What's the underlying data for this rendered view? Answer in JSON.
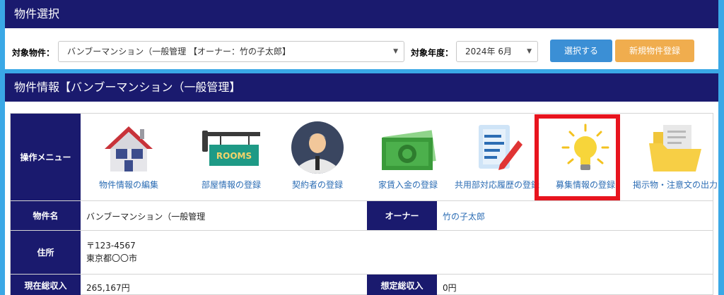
{
  "panel1": {
    "title": "物件選択",
    "property_label": "対象物件：",
    "property_value": "バンブーマンション（一般管理 【オーナー：竹の子太郎】",
    "year_label": "対象年度：",
    "year_value": "2024年 6月",
    "select_button": "選択する",
    "new_button": "新規物件登録"
  },
  "panel2": {
    "title": "物件情報【バンブーマンション（一般管理】",
    "menu_label": "操作メニュー",
    "menu": [
      {
        "label": "物件情報の編集",
        "icon": "house-icon"
      },
      {
        "label": "部屋情報の登録",
        "icon": "rooms-sign-icon",
        "sign_text": "ROOMS"
      },
      {
        "label": "契約者の登録",
        "icon": "person-icon"
      },
      {
        "label": "家賃入金の登録",
        "icon": "money-icon"
      },
      {
        "label": "共用部対応履歴の登録",
        "icon": "document-pen-icon"
      },
      {
        "label": "募集情報の登録",
        "icon": "lightbulb-icon"
      },
      {
        "label": "掲示物・注意文の出力",
        "icon": "folder-icon"
      }
    ],
    "property_name_label": "物件名",
    "property_name": "バンブーマンション（一般管理",
    "owner_label": "オーナー",
    "owner": "竹の子太郎",
    "address_label": "住所",
    "postal": "〒123-4567",
    "address": "東京都〇〇市",
    "income_label": "現在総収入",
    "income": "265,167円",
    "expected_label": "想定総収入",
    "expected": "0円"
  },
  "colors": {
    "navy": "#1a1a6e",
    "background": "#3aa8e6",
    "select_button": "#3b8fd5",
    "new_button": "#f0ad4e",
    "highlight": "#e8141e",
    "link": "#2c6db4"
  }
}
